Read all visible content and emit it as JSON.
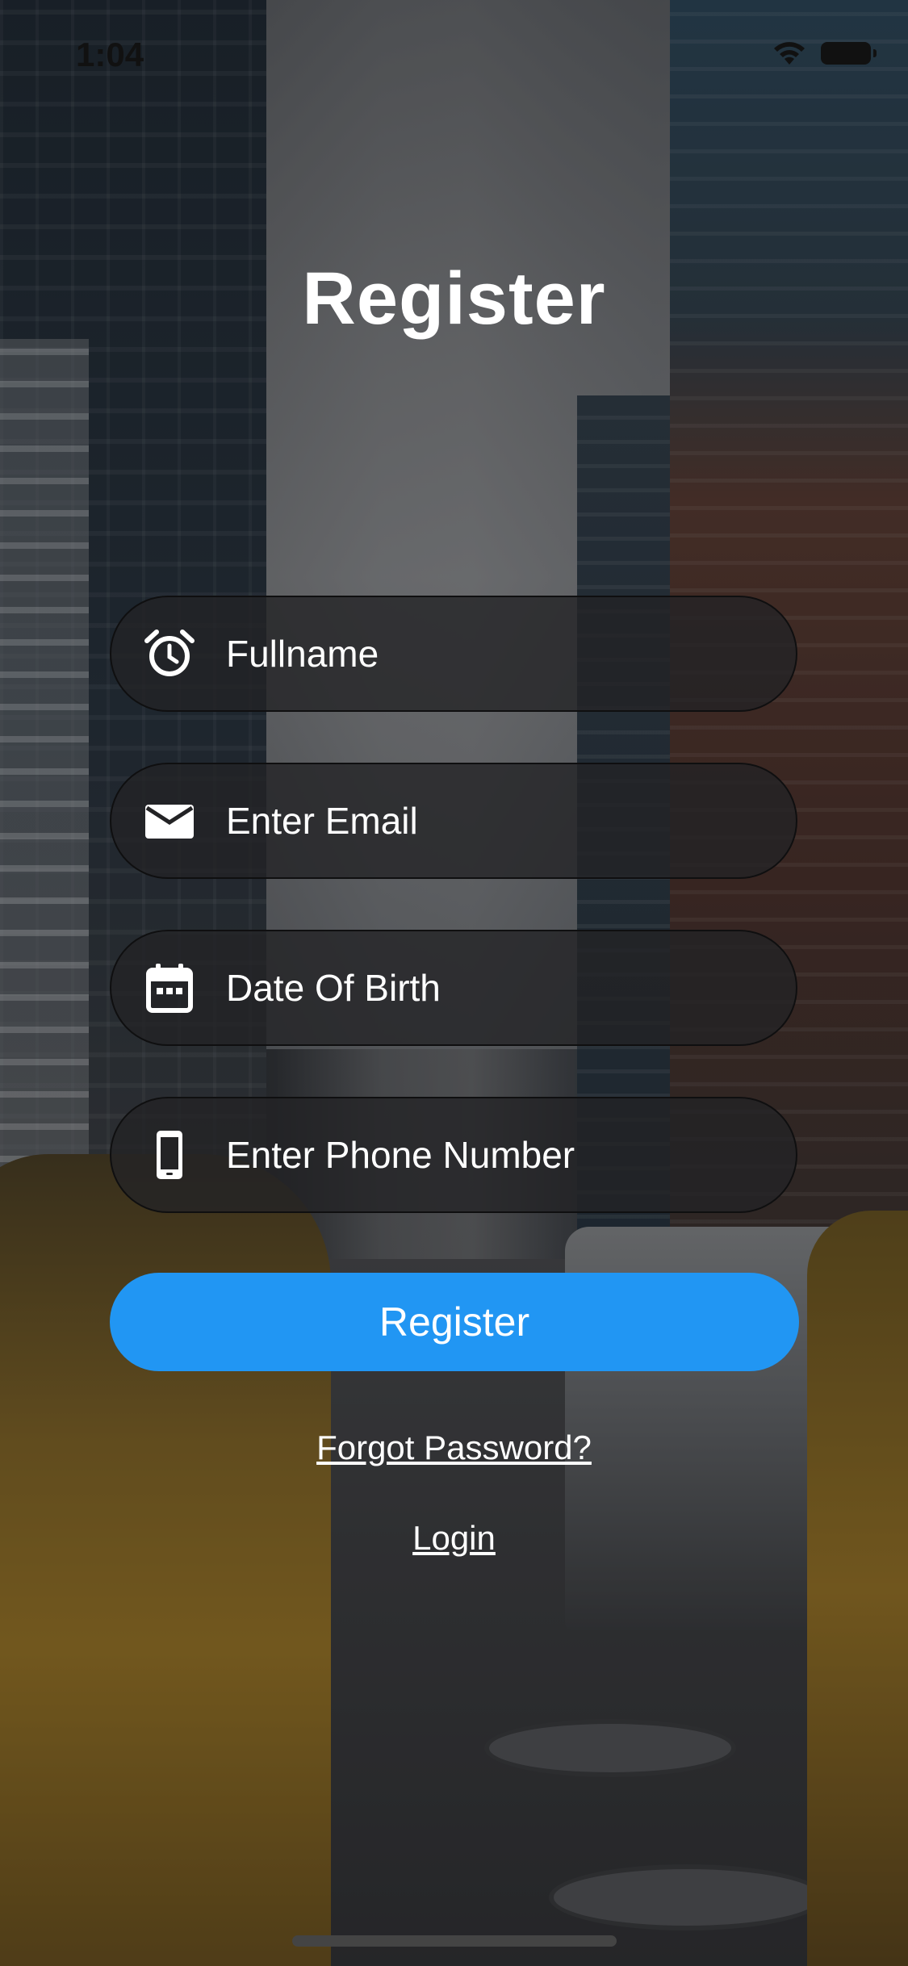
{
  "status_bar": {
    "time": "1:04"
  },
  "page": {
    "title": "Register"
  },
  "form": {
    "fullname": {
      "placeholder": "Fullname",
      "value": "",
      "icon": "alarm-clock-icon"
    },
    "email": {
      "placeholder": "Enter Email",
      "value": "",
      "icon": "envelope-icon"
    },
    "dob": {
      "placeholder": "Date Of Birth",
      "value": "",
      "icon": "calendar-icon"
    },
    "phone": {
      "placeholder": "Enter Phone Number",
      "value": "",
      "icon": "phone-icon"
    }
  },
  "buttons": {
    "register_label": "Register"
  },
  "links": {
    "forgot_password": "Forgot Password?",
    "login": "Login"
  },
  "colors": {
    "accent": "#2196f3",
    "field_bg": "#232325",
    "text": "#ffffff"
  }
}
